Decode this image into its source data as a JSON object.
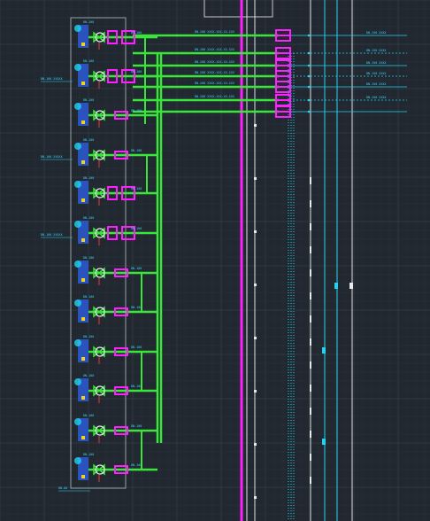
{
  "viewport": {
    "title": "",
    "background": "#212830"
  },
  "colors": {
    "grid_major": "#3a4552",
    "grid_minor": "#2a323c",
    "pipe_green": "#39e639",
    "pipe_magenta": "#ff1fff",
    "cyan": "#22d3ee",
    "blue_fill": "#2c5bd6",
    "white": "#e8e8e8",
    "red": "#ff3030",
    "frame": "#9aa0a6"
  },
  "icons": [
    "valve-icon",
    "pump-icon",
    "flange-icon",
    "gauge-icon"
  ],
  "labels": {
    "left_callouts": [
      "DN-100 XXXXX",
      "DN-100 XXXXX",
      "DN-100 XXXXX",
      "DN-80"
    ],
    "header_runs": [
      "DN-200 XXXX-XXX-XX-XXX",
      "DN-200 XXXX-XXX-XX-XXX",
      "DN-200 XXXX-XXX-XX-XXX",
      "DN-200 XXXX-XXX-XX-XXX",
      "DN-200 XXXX-XXX-XX-XXX",
      "DN-200 XXXX-XXX-XX-XXX"
    ],
    "right_tags": [
      "DN-150 XXXX",
      "DN-150 XXXX",
      "DN-150 XXXX",
      "DN-150 XXXX",
      "DN-150 XXXX",
      "DN-150 XXXX"
    ],
    "branch_tags": [
      "DN-100",
      "DN-100",
      "DN-100",
      "DN-100",
      "DN-100",
      "DN-100",
      "DN-100",
      "DN-100",
      "DN-100",
      "DN-100",
      "DN-100",
      "DN-100"
    ]
  }
}
